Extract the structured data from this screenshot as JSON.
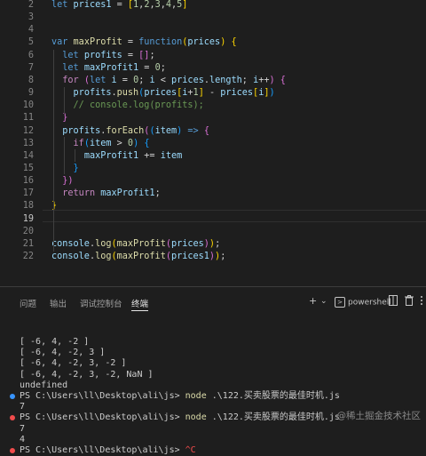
{
  "editor": {
    "lines": [
      {
        "num": "2",
        "tokens": [
          [
            "k",
            "let "
          ],
          [
            "v",
            "prices1"
          ],
          [
            "o",
            " = "
          ],
          [
            "y",
            "["
          ],
          [
            "n",
            "1"
          ],
          [
            "p",
            ","
          ],
          [
            "n",
            "2"
          ],
          [
            "p",
            ","
          ],
          [
            "n",
            "3"
          ],
          [
            "p",
            ","
          ],
          [
            "n",
            "4"
          ],
          [
            "p",
            ","
          ],
          [
            "n",
            "5"
          ],
          [
            "y",
            "]"
          ]
        ]
      },
      {
        "num": "3",
        "tokens": []
      },
      {
        "num": "4",
        "tokens": []
      },
      {
        "num": "5",
        "tokens": [
          [
            "k",
            "var "
          ],
          [
            "f",
            "maxProfit"
          ],
          [
            "o",
            " = "
          ],
          [
            "k",
            "function"
          ],
          [
            "y",
            "("
          ],
          [
            "v",
            "prices"
          ],
          [
            "y",
            ")"
          ],
          [
            "p",
            " "
          ],
          [
            "y",
            "{"
          ]
        ]
      },
      {
        "num": "6",
        "tokens": [
          [
            "p",
            "  "
          ],
          [
            "k",
            "let "
          ],
          [
            "v",
            "profits"
          ],
          [
            "o",
            " = "
          ],
          [
            "m",
            "[]"
          ],
          [
            "p",
            ";"
          ]
        ]
      },
      {
        "num": "7",
        "tokens": [
          [
            "p",
            "  "
          ],
          [
            "k",
            "let "
          ],
          [
            "v",
            "maxProfit1"
          ],
          [
            "o",
            " = "
          ],
          [
            "n",
            "0"
          ],
          [
            "p",
            ";"
          ]
        ]
      },
      {
        "num": "8",
        "tokens": [
          [
            "p",
            "  "
          ],
          [
            "c",
            "for "
          ],
          [
            "m",
            "("
          ],
          [
            "k",
            "let "
          ],
          [
            "v",
            "i"
          ],
          [
            "o",
            " = "
          ],
          [
            "n",
            "0"
          ],
          [
            "p",
            "; "
          ],
          [
            "v",
            "i"
          ],
          [
            "o",
            " < "
          ],
          [
            "v",
            "prices"
          ],
          [
            "p",
            "."
          ],
          [
            "v",
            "length"
          ],
          [
            "p",
            "; "
          ],
          [
            "v",
            "i"
          ],
          [
            "o",
            "++"
          ],
          [
            "m",
            ")"
          ],
          [
            "p",
            " "
          ],
          [
            "m",
            "{"
          ]
        ]
      },
      {
        "num": "9",
        "tokens": [
          [
            "p",
            "    "
          ],
          [
            "v",
            "profits"
          ],
          [
            "p",
            "."
          ],
          [
            "f",
            "push"
          ],
          [
            "b",
            "("
          ],
          [
            "v",
            "prices"
          ],
          [
            "y",
            "["
          ],
          [
            "v",
            "i"
          ],
          [
            "o",
            "+"
          ],
          [
            "n",
            "1"
          ],
          [
            "y",
            "]"
          ],
          [
            "o",
            " - "
          ],
          [
            "v",
            "prices"
          ],
          [
            "y",
            "["
          ],
          [
            "v",
            "i"
          ],
          [
            "y",
            "]"
          ],
          [
            "b",
            ")"
          ]
        ]
      },
      {
        "num": "10",
        "tokens": [
          [
            "p",
            "    "
          ],
          [
            "cm",
            "// console.log(profits);"
          ]
        ]
      },
      {
        "num": "11",
        "tokens": [
          [
            "p",
            "  "
          ],
          [
            "m",
            "}"
          ]
        ]
      },
      {
        "num": "12",
        "tokens": [
          [
            "p",
            "  "
          ],
          [
            "v",
            "profits"
          ],
          [
            "p",
            "."
          ],
          [
            "f",
            "forEach"
          ],
          [
            "m",
            "("
          ],
          [
            "b",
            "("
          ],
          [
            "v",
            "item"
          ],
          [
            "b",
            ")"
          ],
          [
            "o",
            " "
          ],
          [
            "k",
            "=>"
          ],
          [
            "p",
            " "
          ],
          [
            "m",
            "{"
          ]
        ]
      },
      {
        "num": "13",
        "tokens": [
          [
            "p",
            "    "
          ],
          [
            "c",
            "if"
          ],
          [
            "b",
            "("
          ],
          [
            "v",
            "item"
          ],
          [
            "o",
            " > "
          ],
          [
            "n",
            "0"
          ],
          [
            "b",
            ")"
          ],
          [
            "p",
            " "
          ],
          [
            "b",
            "{"
          ]
        ]
      },
      {
        "num": "14",
        "tokens": [
          [
            "p",
            "      "
          ],
          [
            "v",
            "maxProfit1"
          ],
          [
            "o",
            " += "
          ],
          [
            "v",
            "item"
          ]
        ]
      },
      {
        "num": "15",
        "tokens": [
          [
            "p",
            "    "
          ],
          [
            "b",
            "}"
          ]
        ]
      },
      {
        "num": "16",
        "tokens": [
          [
            "p",
            "  "
          ],
          [
            "m",
            "})"
          ]
        ]
      },
      {
        "num": "17",
        "tokens": [
          [
            "p",
            "  "
          ],
          [
            "c",
            "return "
          ],
          [
            "v",
            "maxProfit1"
          ],
          [
            "p",
            ";"
          ]
        ]
      },
      {
        "num": "18",
        "tokens": [
          [
            "y",
            "}"
          ]
        ]
      },
      {
        "num": "19",
        "tokens": [],
        "active": true
      },
      {
        "num": "20",
        "tokens": []
      },
      {
        "num": "21",
        "tokens": [
          [
            "v",
            "console"
          ],
          [
            "p",
            "."
          ],
          [
            "f",
            "log"
          ],
          [
            "y",
            "("
          ],
          [
            "f",
            "maxProfit"
          ],
          [
            "m",
            "("
          ],
          [
            "v",
            "prices"
          ],
          [
            "m",
            ")"
          ],
          [
            "y",
            ")"
          ],
          [
            "p",
            ";"
          ]
        ]
      },
      {
        "num": "22",
        "tokens": [
          [
            "v",
            "console"
          ],
          [
            "p",
            "."
          ],
          [
            "f",
            "log"
          ],
          [
            "y",
            "("
          ],
          [
            "f",
            "maxProfit"
          ],
          [
            "m",
            "("
          ],
          [
            "v",
            "prices1"
          ],
          [
            "m",
            ")"
          ],
          [
            "y",
            ")"
          ],
          [
            "p",
            ";"
          ]
        ]
      }
    ]
  },
  "panel": {
    "tabs": [
      {
        "label": "问题",
        "active": false
      },
      {
        "label": "输出",
        "active": false
      },
      {
        "label": "调试控制台",
        "active": false
      },
      {
        "label": "终端",
        "active": true
      }
    ],
    "toolbar": {
      "add": "+",
      "dropdown": "⌄",
      "shell_name": "powershell",
      "split": "▯▯",
      "trash": "🗑",
      "more": "⋯"
    },
    "terminal": [
      {
        "text": "[ -6, 4, -2 ]",
        "kind": "out"
      },
      {
        "text": "[ -6, 4, -2, 3 ]",
        "kind": "out"
      },
      {
        "text": "[ -6, 4, -2, 3, -2 ]",
        "kind": "out"
      },
      {
        "text": "[ -6, 4, -2, 3, -2, NaN ]",
        "kind": "out"
      },
      {
        "text": "undefined",
        "kind": "out"
      },
      {
        "prompt": "PS C:\\Users\\ll\\Desktop\\ali\\js> ",
        "cmd": "node",
        "arg": " .\\122.买卖股票的最佳时机.js",
        "kind": "prompt",
        "dot": "blue"
      },
      {
        "text": "7",
        "kind": "out"
      },
      {
        "prompt": "PS C:\\Users\\ll\\Desktop\\ali\\js> ",
        "cmd": "node",
        "arg": " .\\122.买卖股票的最佳时机.js",
        "kind": "prompt",
        "dot": "red"
      },
      {
        "text": "7",
        "kind": "out"
      },
      {
        "text": "4",
        "kind": "out"
      },
      {
        "prompt": "PS C:\\Users\\ll\\Desktop\\ali\\js> ",
        "cmd": "^C",
        "arg": "",
        "kind": "prompt",
        "dot": "red"
      }
    ]
  },
  "watermark": "@稀土掘金技术社区"
}
